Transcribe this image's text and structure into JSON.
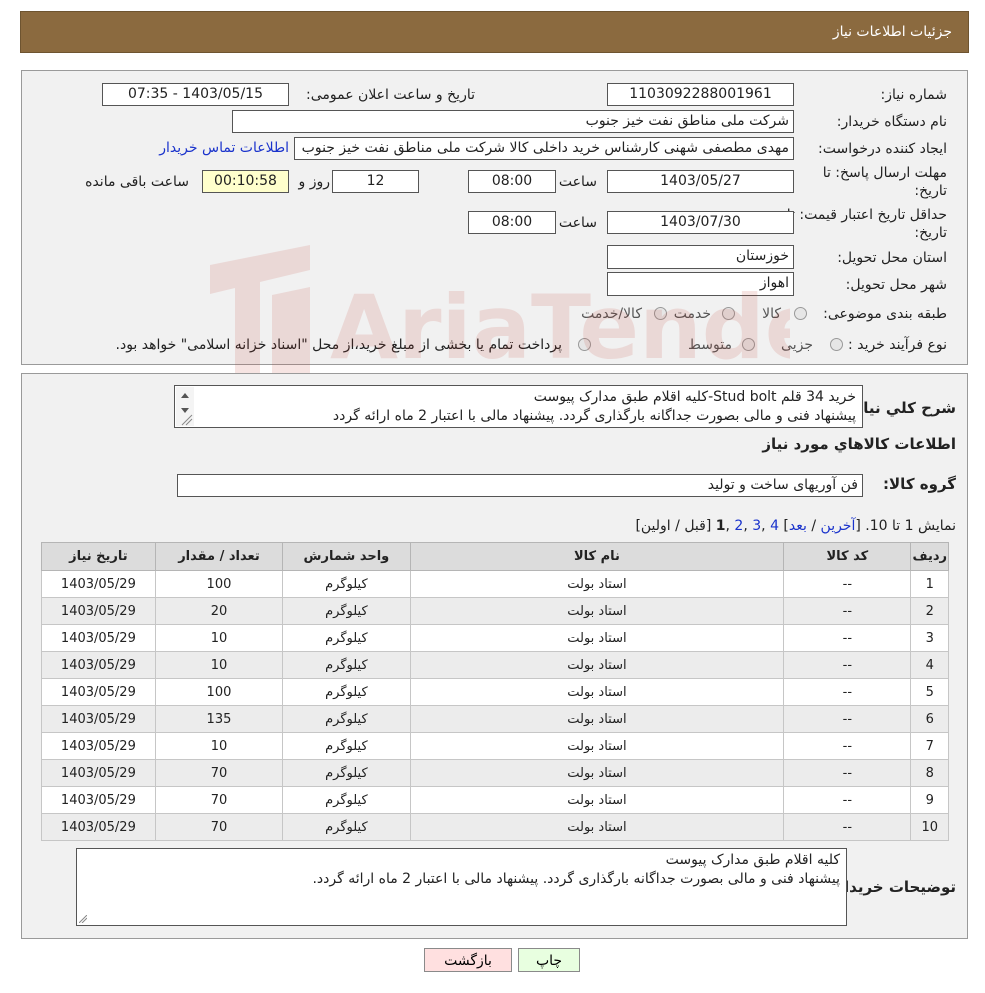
{
  "header": {
    "title": "جزئیات اطلاعات نیاز"
  },
  "form": {
    "need_number_label": "شماره نیاز:",
    "need_number": "1103092288001961",
    "announce_label": "تاریخ و ساعت اعلان عمومی:",
    "announce_value": "1403/05/15 - 07:35",
    "buyer_org_label": "نام دستگاه خریدار:",
    "buyer_org": "شرکت ملی مناطق نفت خیز جنوب",
    "creator_label": "ایجاد کننده درخواست:",
    "creator": "مهدی  مطصفی شهنی کارشناس خرید داخلی کالا  شرکت ملی مناطق نفت خیز جنوب",
    "contact_link": "اطلاعات تماس خریدار",
    "deadline_label_1": "مهلت ارسال پاسخ: تا",
    "deadline_label_2": "تاریخ:",
    "deadline_date": "1403/05/27",
    "time_label": "ساعت",
    "deadline_time": "08:00",
    "days_value": "12",
    "days_label": "روز و",
    "remaining_time": "00:10:58",
    "remaining_label": "ساعت باقی مانده",
    "validity_label_1": "حداقل تاریخ اعتبار قیمت: تا",
    "validity_label_2": "تاریخ:",
    "validity_date": "1403/07/30",
    "validity_time": "08:00",
    "province_label": "استان محل تحویل:",
    "province": "خوزستان",
    "city_label": "شهر محل تحویل:",
    "city": "اهواز",
    "category_label": "طبقه بندی موضوعی:",
    "category_options": [
      "کالا",
      "خدمت",
      "کالا/خدمت"
    ],
    "process_label": "نوع فرآیند خرید :",
    "process_options": [
      "جزیی",
      "متوسط"
    ],
    "process_note": "پرداخت تمام یا بخشی از مبلغ خرید،از محل \"اسناد خزانه اسلامی\" خواهد بود."
  },
  "summary": {
    "label": "شرح کلي نياز:",
    "line1": "خرید 34 قلم Stud bolt-کلیه اقلام طبق مدارک پیوست",
    "line2": "پیشنهاد فنی و مالی بصورت جداگانه بارگذاری گردد. پیشنهاد مالی با اعتبار 2 ماه ارائه گردد",
    "items_title": "اطلاعات کالاهاي مورد نياز",
    "group_label": "گروه کالا:",
    "group_value": "فن آوریهای ساخت و تولید",
    "paging_prefix": "نمایش 1 تا 10. [",
    "paging_last": "آخرین",
    "paging_sep1": " / ",
    "paging_next": "بعد",
    "paging_sep2": "] ",
    "page4": "4",
    "comma1": " ,",
    "page3": "3",
    "comma2": " ,",
    "page2": "2",
    "comma3": " ,",
    "page1": "1",
    "paging_suffix": " [قبل / اولین]"
  },
  "table": {
    "headers": [
      "ردیف",
      "کد کالا",
      "نام کالا",
      "واحد شمارش",
      "تعداد / مقدار",
      "تاریخ نیاز"
    ],
    "rows": [
      [
        "1",
        "--",
        "استاد بولت",
        "کیلوگرم",
        "100",
        "1403/05/29"
      ],
      [
        "2",
        "--",
        "استاد بولت",
        "کیلوگرم",
        "20",
        "1403/05/29"
      ],
      [
        "3",
        "--",
        "استاد بولت",
        "کیلوگرم",
        "10",
        "1403/05/29"
      ],
      [
        "4",
        "--",
        "استاد بولت",
        "کیلوگرم",
        "10",
        "1403/05/29"
      ],
      [
        "5",
        "--",
        "استاد بولت",
        "کیلوگرم",
        "100",
        "1403/05/29"
      ],
      [
        "6",
        "--",
        "استاد بولت",
        "کیلوگرم",
        "135",
        "1403/05/29"
      ],
      [
        "7",
        "--",
        "استاد بولت",
        "کیلوگرم",
        "10",
        "1403/05/29"
      ],
      [
        "8",
        "--",
        "استاد بولت",
        "کیلوگرم",
        "70",
        "1403/05/29"
      ],
      [
        "9",
        "--",
        "استاد بولت",
        "کیلوگرم",
        "70",
        "1403/05/29"
      ],
      [
        "10",
        "--",
        "استاد بولت",
        "کیلوگرم",
        "70",
        "1403/05/29"
      ]
    ]
  },
  "buyer_notes": {
    "label": "توضیحات خریدار:",
    "line1": "کلیه اقلام طبق مدارک پیوست",
    "line2": "پیشنهاد فنی و مالی بصورت جداگانه بارگذاری گردد. پیشنهاد مالی با اعتبار 2 ماه ارائه گردد."
  },
  "buttons": {
    "print": "چاپ",
    "back": "بازگشت"
  },
  "colors": {
    "header_bg": "#8b6a3f",
    "back_button_bg": "#ffe0e0",
    "print_button_bg": "#e8ffe0",
    "link": "#1a33cc"
  }
}
